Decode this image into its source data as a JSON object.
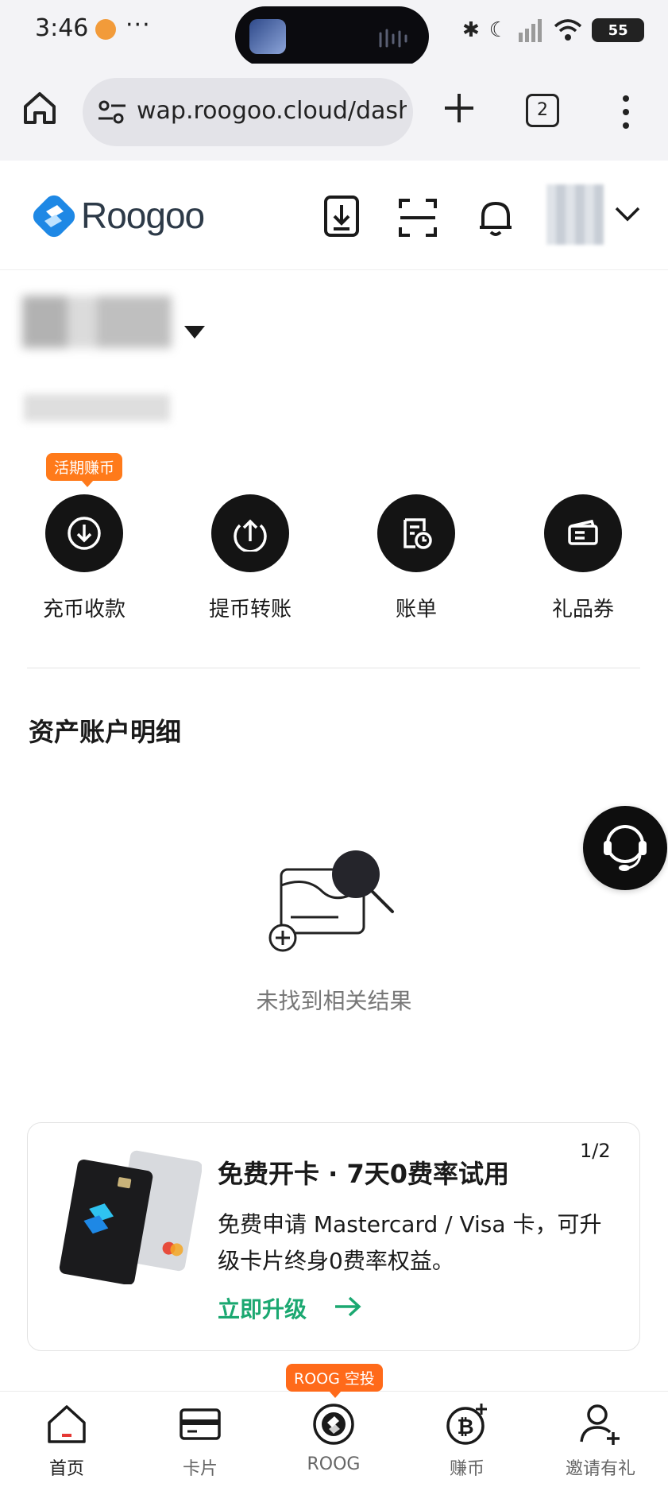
{
  "status_bar": {
    "time": "3:46",
    "more": "···",
    "battery": "55"
  },
  "browser": {
    "url": "wap.roogoo.cloud/dash",
    "tab_count": "2"
  },
  "header": {
    "logo_text": "Roogoo"
  },
  "actions": {
    "badge": "活期赚币",
    "items": [
      {
        "label": "充币收款",
        "icon": "deposit-icon"
      },
      {
        "label": "提币转账",
        "icon": "withdraw-icon"
      },
      {
        "label": "账单",
        "icon": "bill-icon"
      },
      {
        "label": "礼品券",
        "icon": "gift-voucher-icon"
      }
    ]
  },
  "assets": {
    "title": "资产账户明细",
    "empty_text": "未找到相关结果"
  },
  "promo": {
    "title": "免费开卡 · 7天0费率试用",
    "page": "1/2",
    "description": "免费申请 Mastercard / Visa 卡，可升级卡片终身0费率权益。",
    "cta": "立即升级"
  },
  "bottom_nav": {
    "airdrop_badge": "ROOG 空投",
    "items": [
      {
        "label": "首页",
        "icon": "home-icon"
      },
      {
        "label": "卡片",
        "icon": "card-icon"
      },
      {
        "label": "ROOG",
        "icon": "roog-coin-icon"
      },
      {
        "label": "赚币",
        "icon": "bitcoin-earn-icon"
      },
      {
        "label": "邀请有礼",
        "icon": "invite-user-icon"
      }
    ]
  },
  "colors": {
    "accent_orange": "#ff7a1a",
    "cta_green": "#1ba871",
    "logo_blue": "#1e88e5"
  }
}
